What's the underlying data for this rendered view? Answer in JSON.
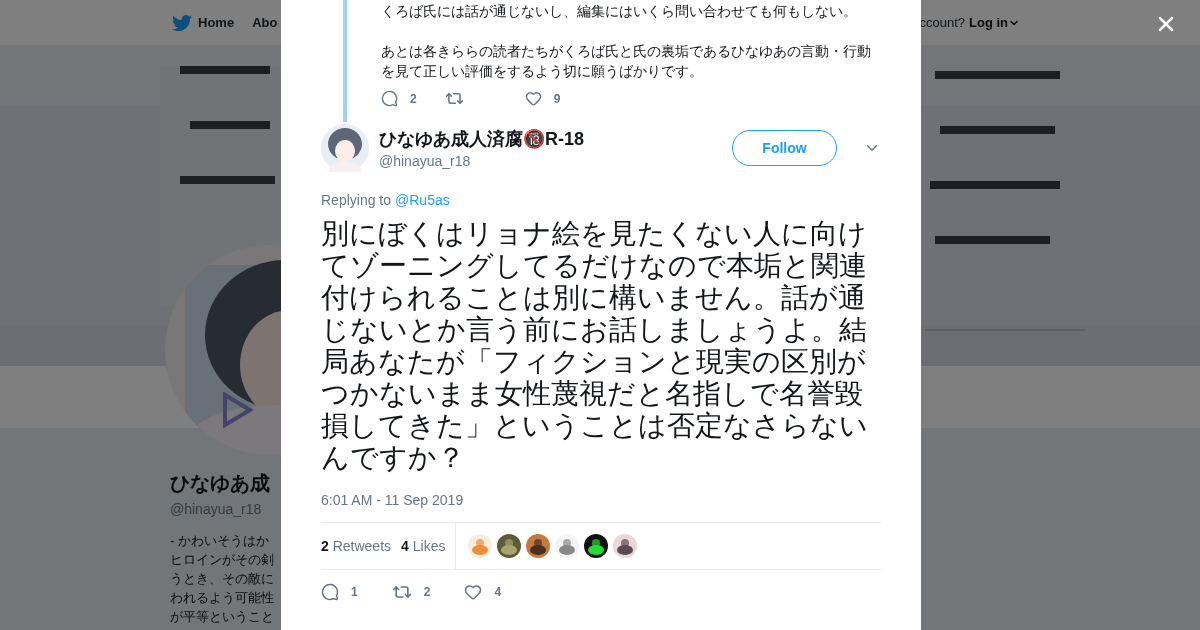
{
  "nav": {
    "items": [
      {
        "label": "Home"
      },
      {
        "label": "Abo"
      }
    ],
    "account_prompt": "ccount?",
    "login": "Log in"
  },
  "profile": {
    "name": "ひなゆあ成",
    "handle": "@hinayua_r18",
    "bio_lines": [
      "- かわいそうはか",
      "ヒロインがその剣",
      "うとき、その敵に",
      "われるよう可能性",
      "が平等ということ"
    ]
  },
  "parent_tweet": {
    "paragraphs": [
      "くろば氏には話が通じないし、編集にはいくら問い合わせても何もしない。",
      "あとは各きららの読者たちがくろば氏と氏の裏垢であるひなゆあの言動・行動を見て正しい評価をするよう切に願うばかりです。"
    ],
    "replies": "2",
    "likes": "9"
  },
  "tweet": {
    "name": "ひなゆあ成人済腐🔞R-18",
    "handle": "@hinayua_r18",
    "follow": "Follow",
    "replying_label": "Replying to",
    "replying_to": "@Ru5as",
    "text": "別にぼくはリョナ絵を見たくない人に向けてゾーニングしてるだけなので本垢と関連付けられることは別に構いません。話が通じないとか言う前にお話しましょうよ。結局あなたが「フィクションと現実の区別がつかないまま女性蔑視だと名指しで名誉毀損してきた」ということは否定なさらないんですか？",
    "time": "6:01 AM - 11 Sep 2019",
    "retweets": "2",
    "retweets_label": "Retweets",
    "likes": "4",
    "likes_label": "Likes",
    "actions": {
      "replies": "1",
      "retweets": "2",
      "likes": "4"
    }
  }
}
